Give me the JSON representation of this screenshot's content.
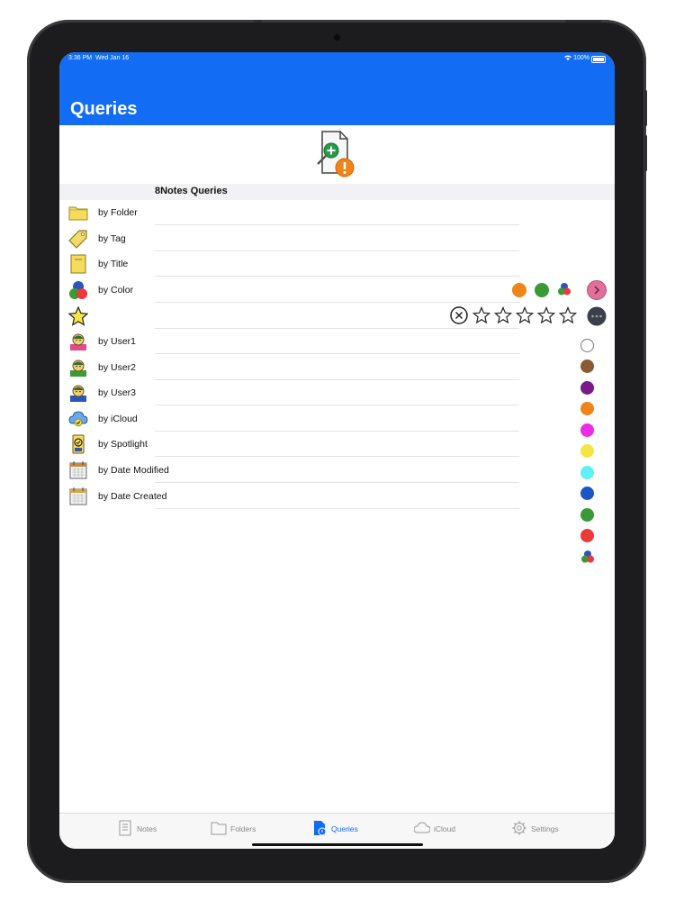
{
  "status": {
    "time": "3:36 PM",
    "date": "Wed Jan 16",
    "battery": "100%"
  },
  "nav": {
    "title": "Queries"
  },
  "hero": {
    "icon": "add-query-icon"
  },
  "section": {
    "title": "8Notes Queries"
  },
  "rows": [
    {
      "label": "by Folder",
      "icon": "folder-icon"
    },
    {
      "label": "by Tag",
      "icon": "tag-icon"
    },
    {
      "label": "by Title",
      "icon": "note-icon"
    },
    {
      "label": "by Color",
      "icon": "color-circles-icon"
    },
    {
      "label": "",
      "icon": "star-icon"
    },
    {
      "label": "by User1",
      "icon": "user1-icon"
    },
    {
      "label": "by User2",
      "icon": "user2-icon"
    },
    {
      "label": "by User3",
      "icon": "user3-icon"
    },
    {
      "label": "by iCloud",
      "icon": "icloud-icon"
    },
    {
      "label": "by Spotlight",
      "icon": "spotlight-icon"
    },
    {
      "label": "by Date Modified",
      "icon": "calendar-icon"
    },
    {
      "label": "by Date Created",
      "icon": "calendar-icon"
    }
  ],
  "color_row": {
    "selected_colors": [
      "#f08418",
      "#3a9a36",
      "multi"
    ],
    "accessory": "chevron-right-icon",
    "accent": "#e0709a"
  },
  "rating_row": {
    "max_stars": 5,
    "rating": 0,
    "clear": "clear-x-icon",
    "accessory": "more-icon"
  },
  "palette": [
    "#ffffff",
    "#8b5a35",
    "#7a1a86",
    "#f08418",
    "#ea2ce2",
    "#f6e442",
    "#5ff0f2",
    "#1c56c6",
    "#3a9a36",
    "#ea3a3a",
    "multi"
  ],
  "tabs": [
    {
      "label": "Notes",
      "icon": "notes-icon",
      "active": false
    },
    {
      "label": "Folders",
      "icon": "folder-icon",
      "active": false
    },
    {
      "label": "Queries",
      "icon": "queries-icon",
      "active": true
    },
    {
      "label": "iCloud",
      "icon": "cloud-icon",
      "active": false
    },
    {
      "label": "Settings",
      "icon": "gear-icon",
      "active": false
    }
  ],
  "colors": {
    "nav": "#136cf4",
    "accent": "#136cf4"
  }
}
